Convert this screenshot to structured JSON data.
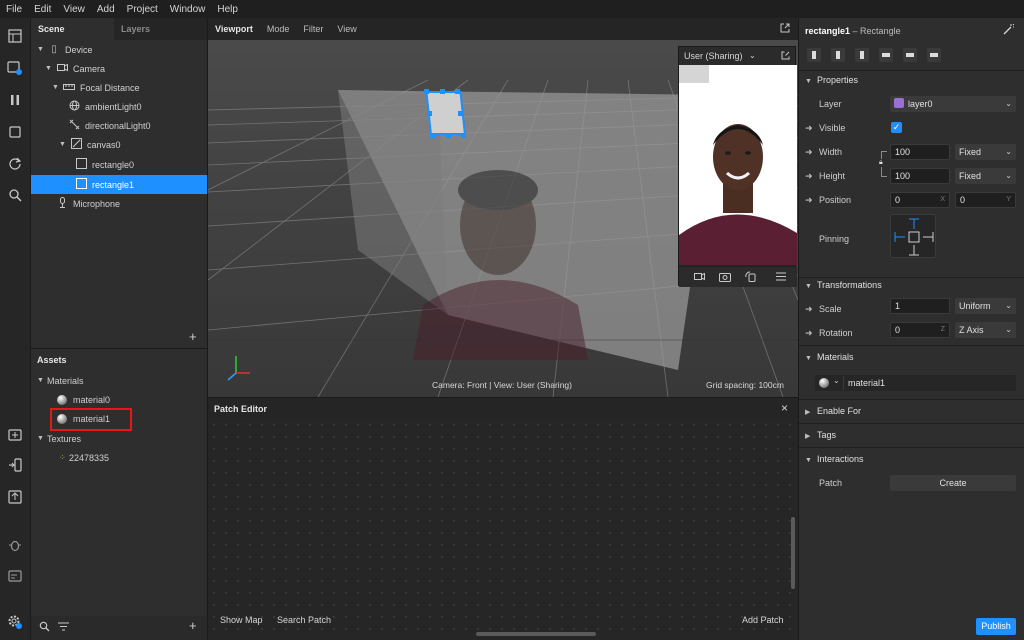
{
  "menu": [
    "File",
    "Edit",
    "View",
    "Add",
    "Project",
    "Window",
    "Help"
  ],
  "scene_panel": {
    "tabs": [
      "Scene",
      "Layers"
    ],
    "tree": [
      {
        "label": "Device",
        "icon": "device-icon",
        "depth": 0,
        "expanded": true
      },
      {
        "label": "Camera",
        "icon": "camera-icon",
        "depth": 1,
        "expanded": true
      },
      {
        "label": "Focal Distance",
        "icon": "focal-distance-icon",
        "depth": 2,
        "expanded": true
      },
      {
        "label": "ambientLight0",
        "icon": "ambient-light-icon",
        "depth": 3
      },
      {
        "label": "directionalLight0",
        "icon": "directional-light-icon",
        "depth": 3
      },
      {
        "label": "canvas0",
        "icon": "canvas-icon",
        "depth": 3,
        "expanded": true
      },
      {
        "label": "rectangle0",
        "icon": "rectangle-icon",
        "depth": 4
      },
      {
        "label": "rectangle1",
        "icon": "rectangle-icon",
        "depth": 4,
        "selected": true
      },
      {
        "label": "Microphone",
        "icon": "microphone-icon",
        "depth": 1
      }
    ],
    "add_glyph": "+"
  },
  "assets_panel": {
    "title": "Assets",
    "materials_label": "Materials",
    "materials": [
      "material0",
      "material1"
    ],
    "highlighted_material": "material1",
    "textures_label": "Textures",
    "textures": [
      "22478335"
    ]
  },
  "viewport": {
    "tabs": [
      "Viewport",
      "Mode",
      "Filter",
      "View"
    ],
    "status_left": "Camera: Front | View: User (Sharing)",
    "status_right": "Grid spacing: 100cm",
    "preview_title": "User (Sharing)"
  },
  "patch_editor": {
    "title": "Patch Editor",
    "close_glyph": "×",
    "show_map": "Show Map",
    "search_patch": "Search Patch",
    "add_patch": "Add Patch"
  },
  "inspector": {
    "object_name": "rectangle1",
    "object_type": "– Rectangle",
    "properties_label": "Properties",
    "layer_label": "Layer",
    "layer_value": "layer0",
    "layer_color": "#9a6fd6",
    "visible_label": "Visible",
    "visible_checked": true,
    "width_label": "Width",
    "width_value": "100",
    "width_mode": "Fixed",
    "height_label": "Height",
    "height_value": "100",
    "height_mode": "Fixed",
    "position_label": "Position",
    "position_x": "0",
    "position_x_axis": "X",
    "position_y": "0",
    "position_y_axis": "Y",
    "pinning_label": "Pinning",
    "transformations_label": "Transformations",
    "scale_label": "Scale",
    "scale_value": "1",
    "scale_mode": "Uniform",
    "rotation_label": "Rotation",
    "rotation_value": "0",
    "rotation_axis_letter": "Z",
    "rotation_axis": "Z Axis",
    "materials_label": "Materials",
    "material_value": "material1",
    "enable_for_label": "Enable For",
    "tags_label": "Tags",
    "interactions_label": "Interactions",
    "patch_label": "Patch",
    "create_label": "Create",
    "publish_label": "Publish",
    "accent": "#1e90ff"
  }
}
